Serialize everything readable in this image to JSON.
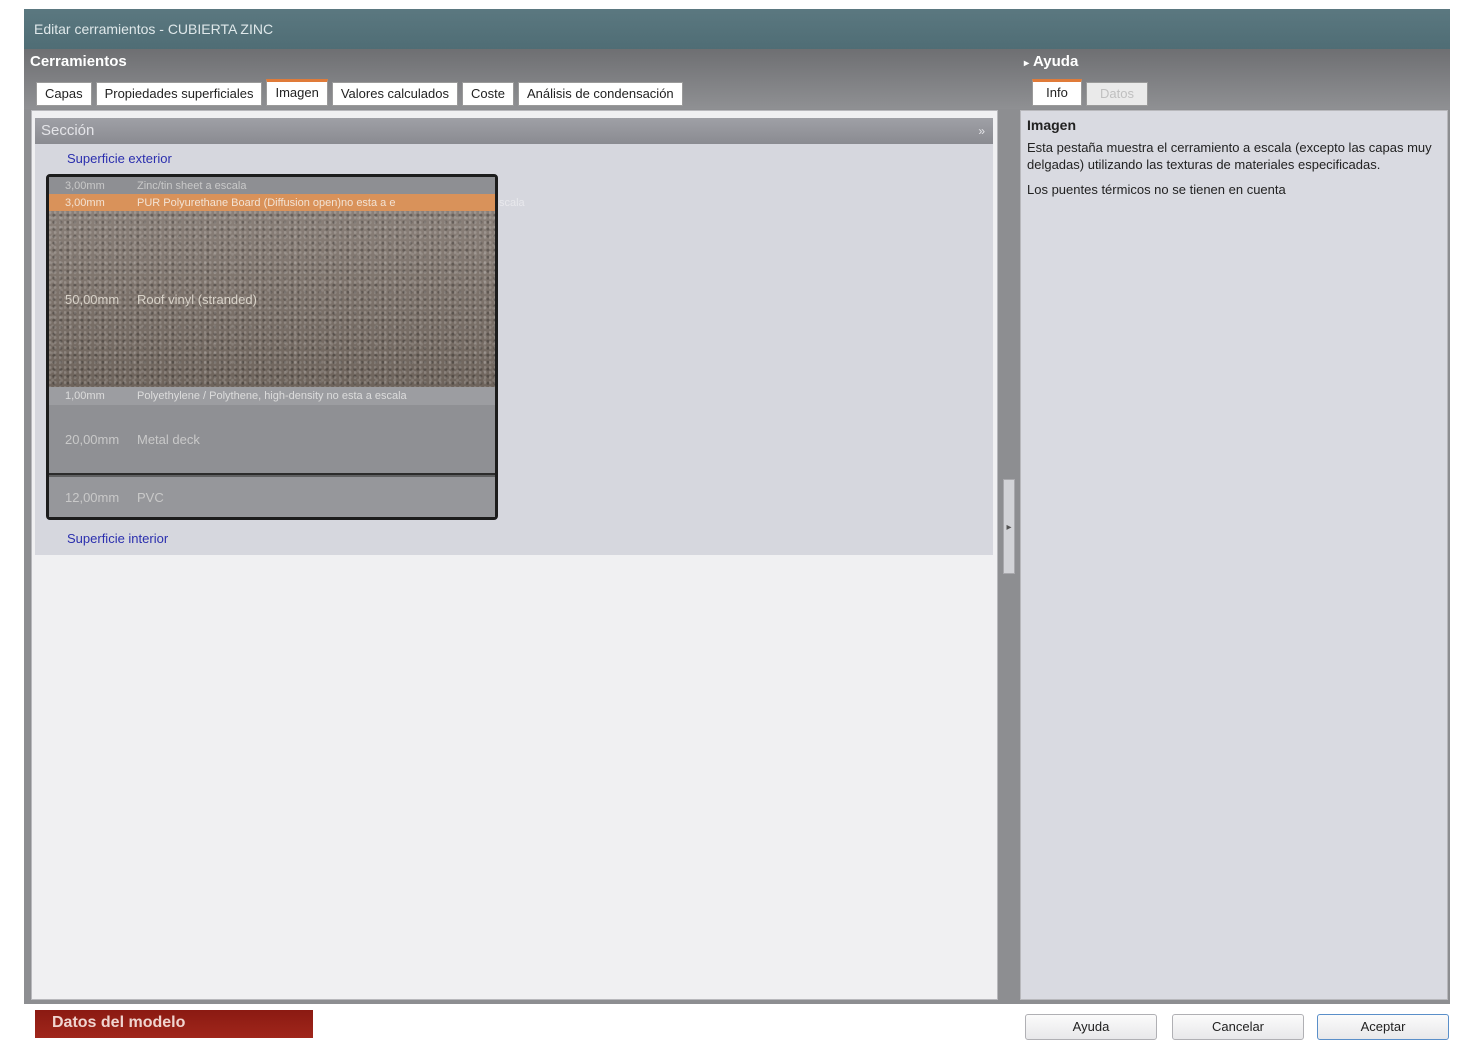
{
  "window": {
    "title": "Editar cerramientos - CUBIERTA ZINC"
  },
  "left": {
    "section_title": "Cerramientos",
    "tabs": [
      {
        "label": "Capas"
      },
      {
        "label": "Propiedades superficiales"
      },
      {
        "label": "Imagen",
        "active": true
      },
      {
        "label": "Valores calculados"
      },
      {
        "label": "Coste"
      },
      {
        "label": "Análisis de condensación"
      }
    ],
    "seccion": {
      "header": "Sección",
      "chevron": "»",
      "outer_surface": "Superficie exterior",
      "inner_surface": "Superficie interior",
      "layers": [
        {
          "thickness": "3,00mm",
          "material": "Zinc/tin sheet a escala"
        },
        {
          "thickness": "3,00mm",
          "material": "PUR Polyurethane Board (Diffusion open)no esta a e",
          "overflow": "scala"
        },
        {
          "thickness": "50,00mm",
          "material": "Roof vinyl (stranded)"
        },
        {
          "thickness": "1,00mm",
          "material": "Polyethylene / Polythene, high-density no esta a escala"
        },
        {
          "thickness": "20,00mm",
          "material": "Metal deck"
        },
        {
          "thickness": "12,00mm",
          "material": "PVC"
        }
      ]
    }
  },
  "right": {
    "section_title": "Ayuda",
    "tabs": [
      {
        "label": "Info",
        "active": true
      },
      {
        "label": "Datos",
        "disabled": true
      }
    ],
    "help": {
      "title": "Imagen",
      "paragraph1": "Esta pestaña muestra el cerramiento a escala (excepto las capas muy delgadas) utilizando las texturas de materiales especificadas.",
      "paragraph2": "Los puentes térmicos no se tienen en cuenta"
    }
  },
  "bottom": {
    "model_data": "Datos del modelo",
    "help_button": "Ayuda",
    "cancel_button": "Cancelar",
    "accept_button": "Aceptar"
  }
}
